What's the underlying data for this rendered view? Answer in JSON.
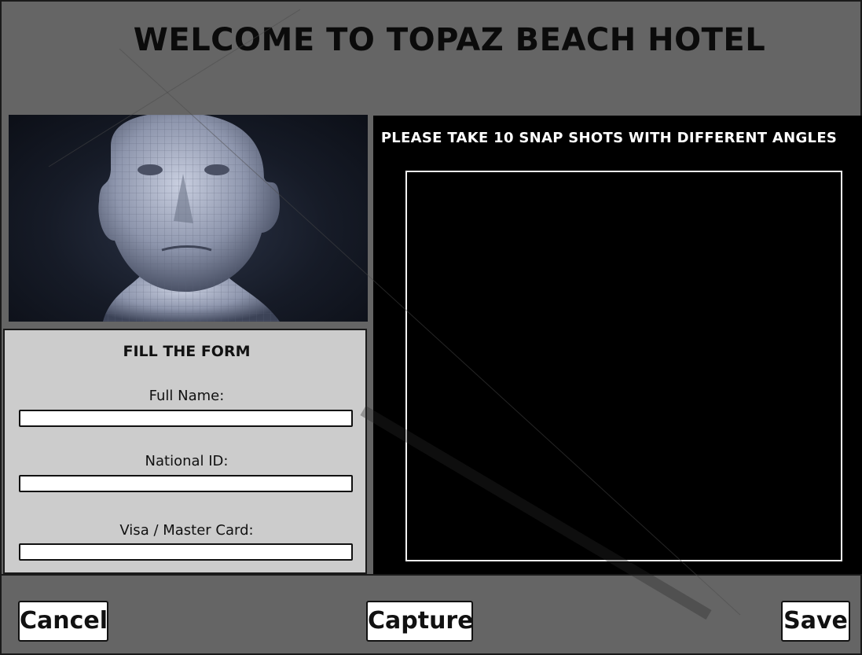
{
  "header": {
    "title": "WELCOME TO TOPAZ BEACH HOTEL"
  },
  "photo": {
    "alt": "3D wireframe face"
  },
  "form": {
    "title": "FILL THE FORM",
    "fields": [
      {
        "label": "Full Name:",
        "value": ""
      },
      {
        "label": "National ID:",
        "value": ""
      },
      {
        "label": "Visa / Master Card:",
        "value": ""
      }
    ]
  },
  "snapshot": {
    "instruction": "PLEASE TAKE 10 SNAP SHOTS WITH DIFFERENT ANGLES"
  },
  "footer": {
    "cancel_label": "Cancel",
    "capture_label": "Capture",
    "save_label": "Save"
  },
  "colors": {
    "background": "#656565",
    "form_panel": "#cccccc",
    "snapshot_panel": "#000000"
  }
}
